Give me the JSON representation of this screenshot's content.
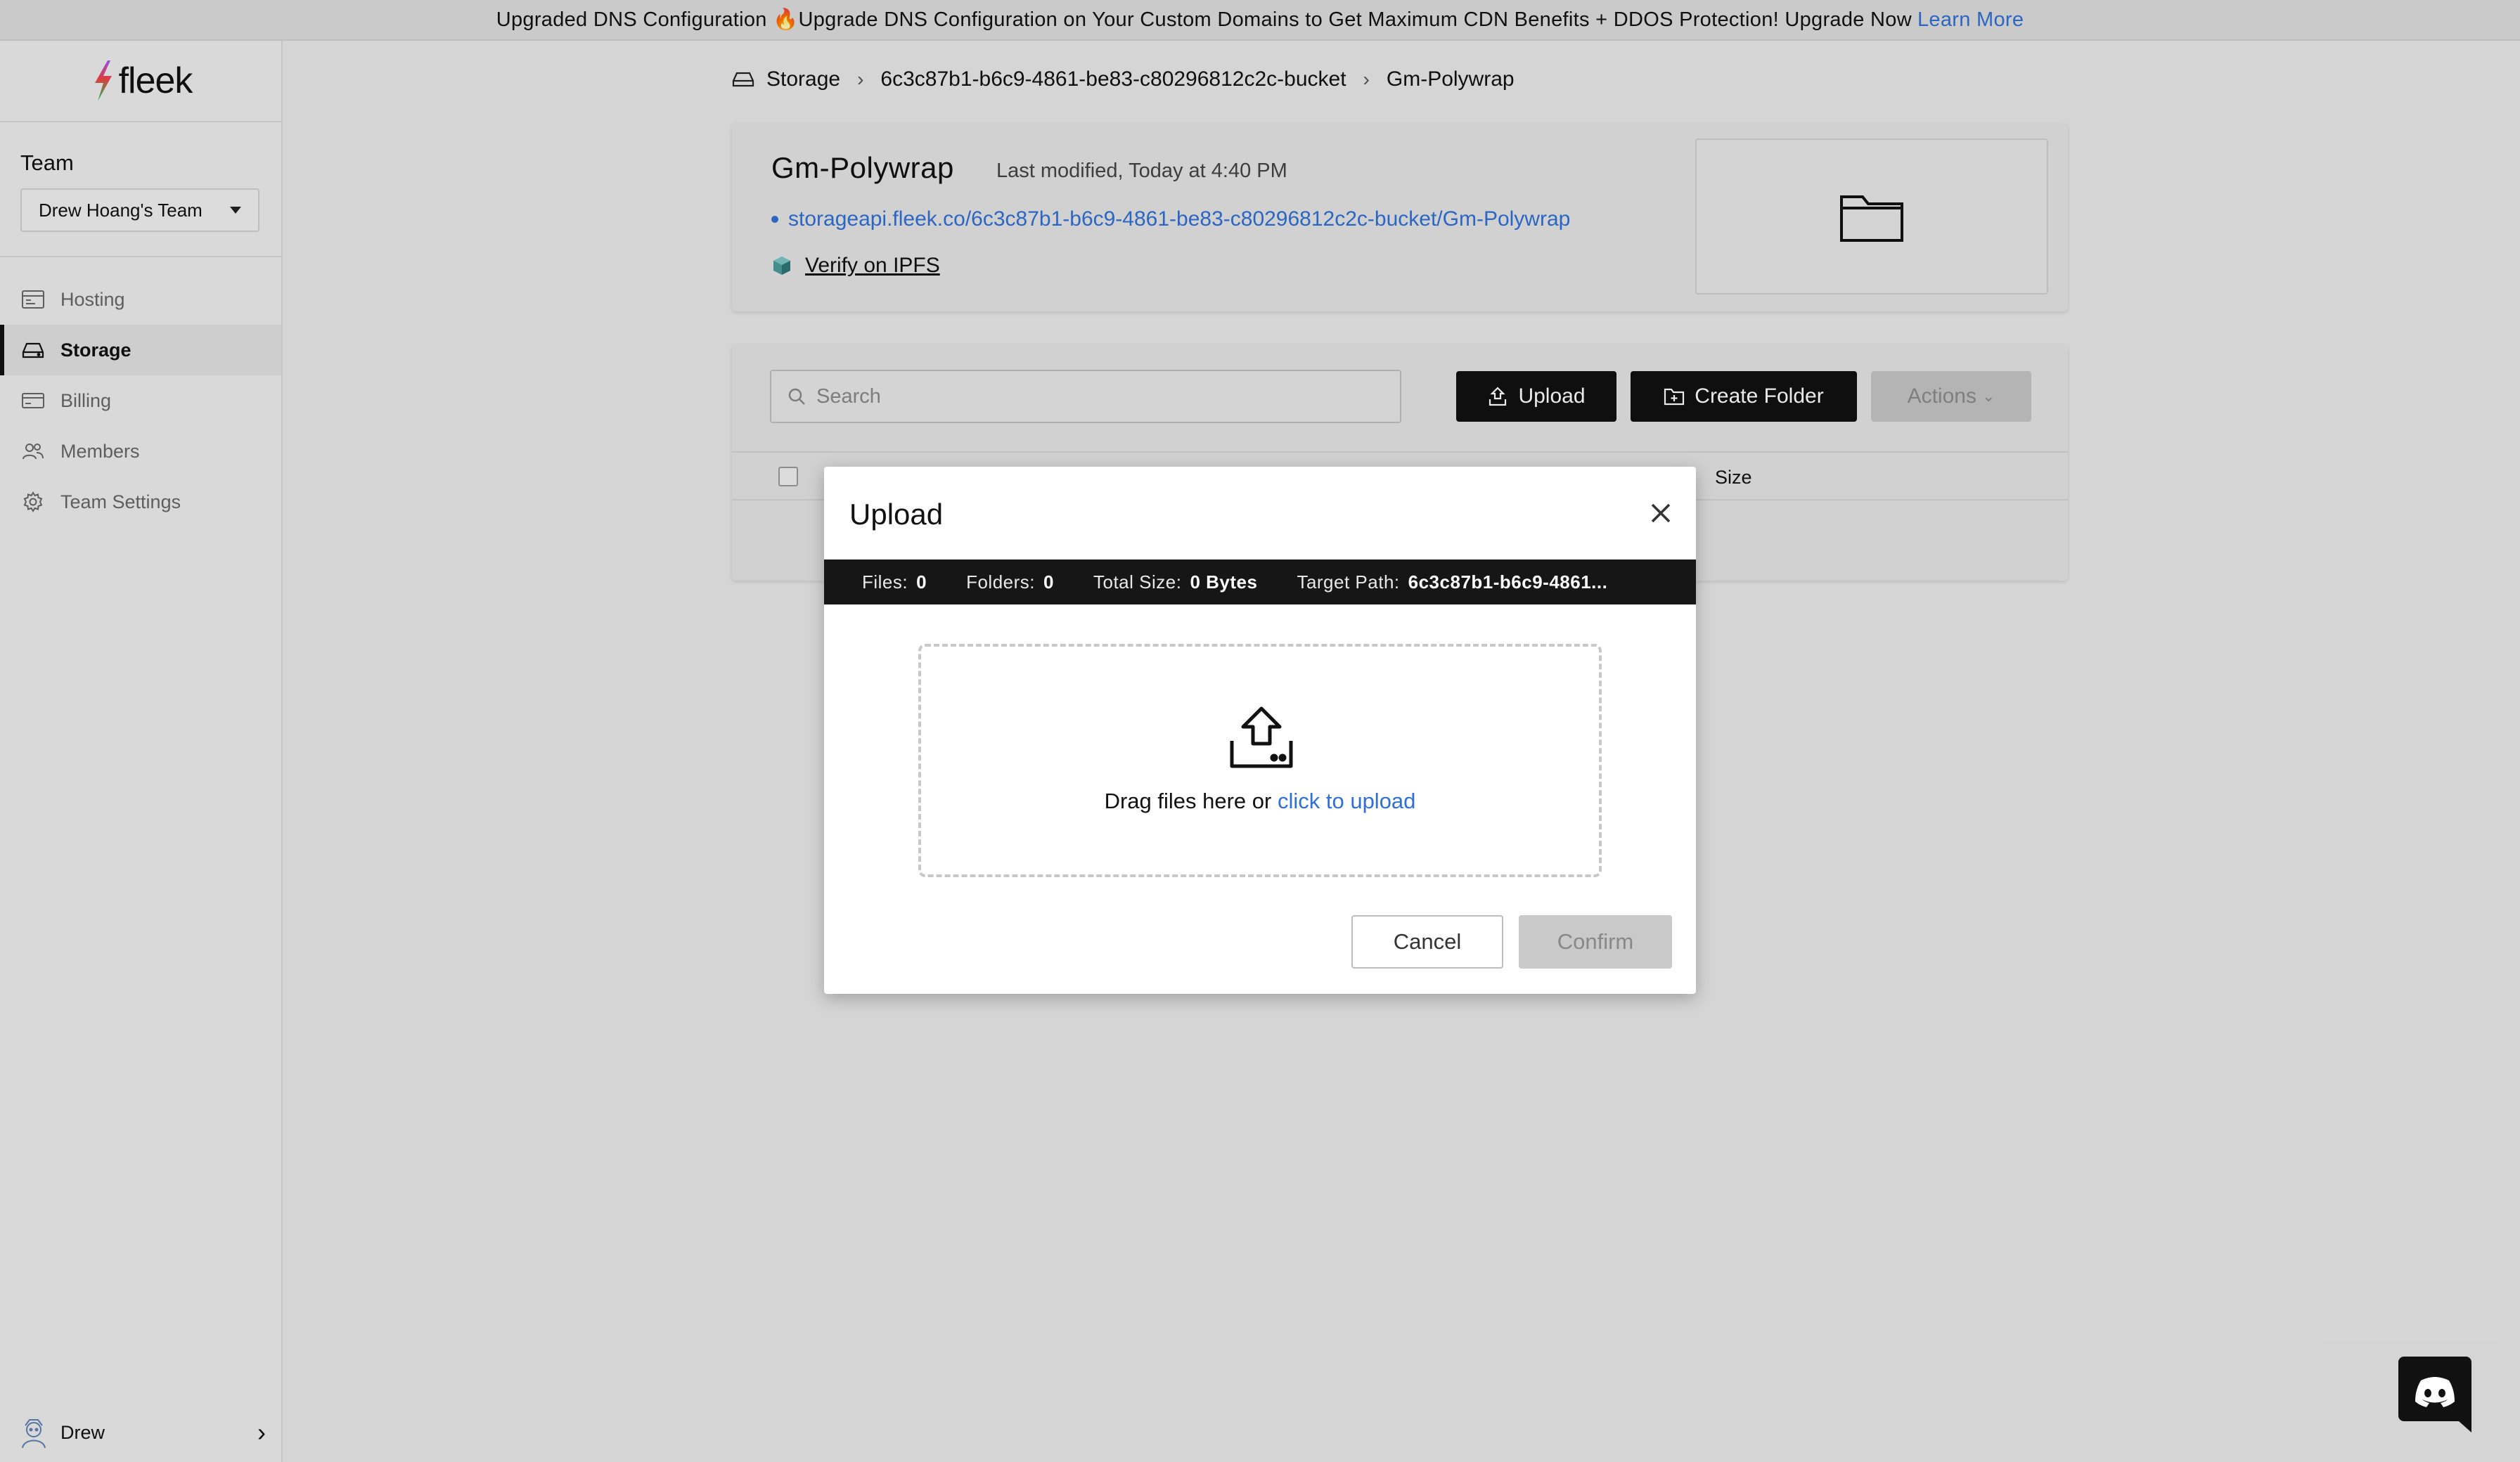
{
  "banner": {
    "text": "Upgraded DNS Configuration 🔥Upgrade DNS Configuration on Your Custom Domains to Get Maximum CDN Benefits + DDOS Protection! Upgrade Now",
    "link": "Learn More",
    "link_color": "#2f6fd6"
  },
  "sidebar": {
    "logo": "fleek",
    "team_heading": "Team",
    "team_select": "Drew Hoang's Team",
    "items": [
      {
        "label": "Hosting",
        "icon": "browser-window-icon"
      },
      {
        "label": "Storage",
        "icon": "drive-icon",
        "active": true
      },
      {
        "label": "Billing",
        "icon": "credit-card-icon"
      },
      {
        "label": "Members",
        "icon": "users-icon"
      },
      {
        "label": "Team Settings",
        "icon": "gear-icon"
      }
    ],
    "user": "Drew"
  },
  "breadcrumb": {
    "root": "Storage",
    "bucket": "6c3c87b1-b6c9-4861-be83-c80296812c2c-bucket",
    "current": "Gm-Polywrap"
  },
  "info": {
    "title": "Gm-Polywrap",
    "modified": "Last modified, Today at 4:40 PM",
    "url": "storageapi.fleek.co/6c3c87b1-b6c9-4861-be83-c80296812c2c-bucket/Gm-Polywrap",
    "verify": "Verify on IPFS"
  },
  "toolbar": {
    "search_placeholder": "Search",
    "upload": "Upload",
    "create_folder": "Create Folder",
    "actions": "Actions"
  },
  "table": {
    "columns": [
      "Size"
    ]
  },
  "modal": {
    "title": "Upload",
    "files_label": "Files:",
    "files_value": "0",
    "folders_label": "Folders:",
    "folders_value": "0",
    "size_label": "Total Size:",
    "size_value": "0 Bytes",
    "path_label": "Target Path:",
    "path_value": "6c3c87b1-b6c9-4861...",
    "drop_text": "Drag files here or",
    "drop_link": "click to upload",
    "cancel": "Cancel",
    "confirm": "Confirm"
  }
}
